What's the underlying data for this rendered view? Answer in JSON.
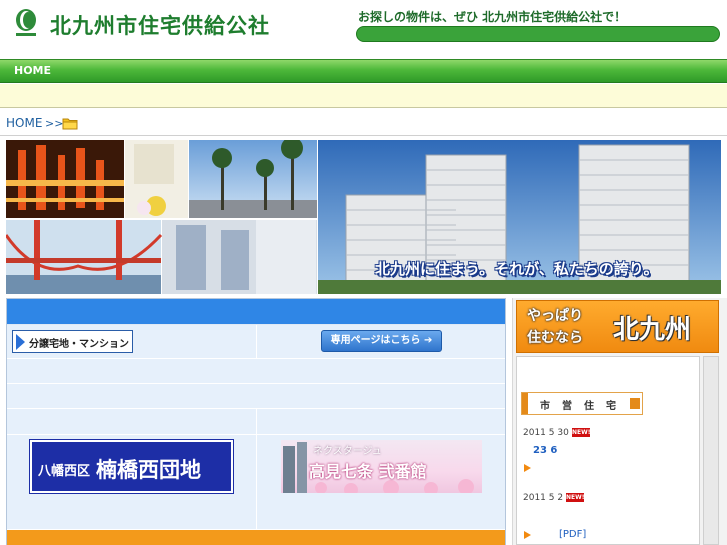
{
  "header": {
    "site_title": "北九州市住宅供給公社",
    "tagline": "お探しの物件は、ぜひ 北九州市住宅供給公社で！"
  },
  "nav": {
    "home_label": "HOME"
  },
  "breadcrumb": {
    "home": "HOME",
    "separator": ">>"
  },
  "hero": {
    "caption": "北九州に住まう。それが、私たちの誇り。"
  },
  "main": {
    "subdivision_label": "分譲宅地・マンション",
    "special_page_label": "専用ページはこちら",
    "banner_kusu": {
      "ward": "八幡西区",
      "name": "楠橋西団地"
    },
    "banner_takami": {
      "line1": "ネクスタージュ",
      "line2": "高見七条 弐番館"
    }
  },
  "right": {
    "yappari_line1": "やっぱり",
    "yappari_line2": "住むなら",
    "yappari_city": "北九州",
    "section_label": "市営住宅",
    "news": [
      {
        "date": "2011 5 30",
        "badge": "NEW!",
        "text": "23  6"
      },
      {
        "date": "2011 5 2",
        "badge": "NEW!",
        "text": "[PDF]"
      }
    ]
  },
  "colors": {
    "brand_green": "#1e7d2e",
    "nav_green": "#4db83a",
    "main_blue": "#2f86e6",
    "accent_orange": "#f39a1b"
  }
}
